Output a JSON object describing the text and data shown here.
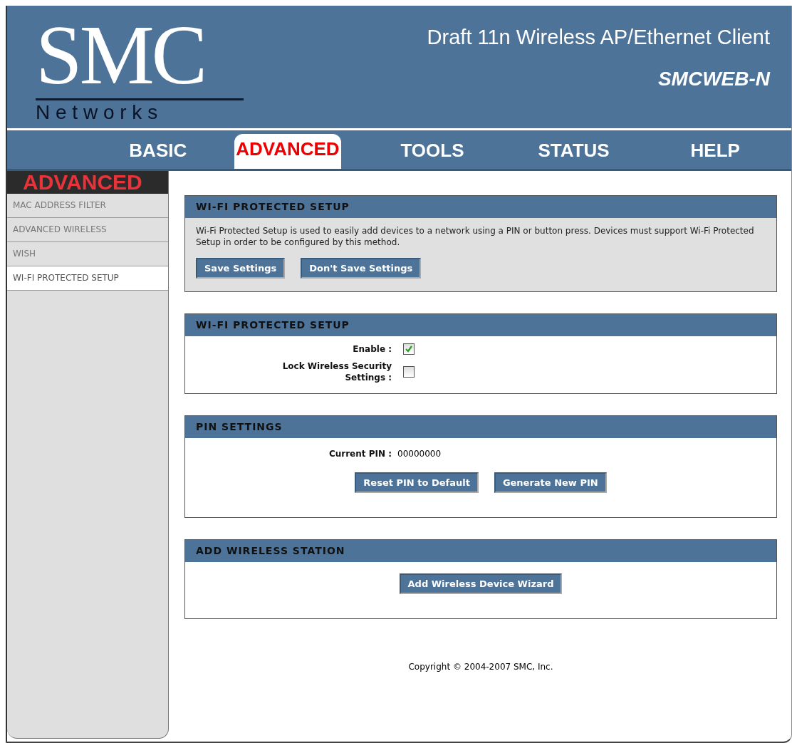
{
  "header": {
    "logo": "SMC",
    "logo_sub": "N e t w o r k s",
    "product": "Draft 11n Wireless AP/Ethernet Client",
    "model": "SMCWEB-N"
  },
  "nav": [
    {
      "label": "BASIC",
      "selected": false
    },
    {
      "label": "ADVANCED",
      "selected": true
    },
    {
      "label": "TOOLS",
      "selected": false
    },
    {
      "label": "STATUS",
      "selected": false
    },
    {
      "label": "HELP",
      "selected": false
    }
  ],
  "sidebar": {
    "title": "ADVANCED",
    "items": [
      {
        "label": "MAC ADDRESS FILTER",
        "selected": false
      },
      {
        "label": "ADVANCED WIRELESS",
        "selected": false
      },
      {
        "label": "WISH",
        "selected": false
      },
      {
        "label": "WI-FI PROTECTED SETUP",
        "selected": true
      }
    ]
  },
  "sections": [
    {
      "kind": "intro",
      "title": "WI-FI PROTECTED SETUP",
      "text": "Wi-Fi Protected Setup is used to easily add devices to a network using a PIN or button press. Devices must support Wi-Fi Protected Setup in order to be configured by this method.",
      "buttons": [
        "Save Settings",
        "Don't Save Settings"
      ]
    },
    {
      "kind": "checkboxes",
      "title": "WI-FI PROTECTED SETUP",
      "fields": [
        {
          "label": "Enable :",
          "checked": true
        },
        {
          "label": "Lock Wireless Security Settings :",
          "checked": false
        }
      ]
    },
    {
      "kind": "pin",
      "title": "PIN SETTINGS",
      "label": "Current PIN :",
      "value": "00000000",
      "buttons": [
        "Reset PIN to Default",
        "Generate New PIN"
      ]
    },
    {
      "kind": "actions",
      "title": "ADD WIRELESS STATION",
      "buttons": [
        "Add Wireless Device Wizard"
      ]
    }
  ],
  "footer": "Copyright © 2004-2007 SMC, Inc."
}
